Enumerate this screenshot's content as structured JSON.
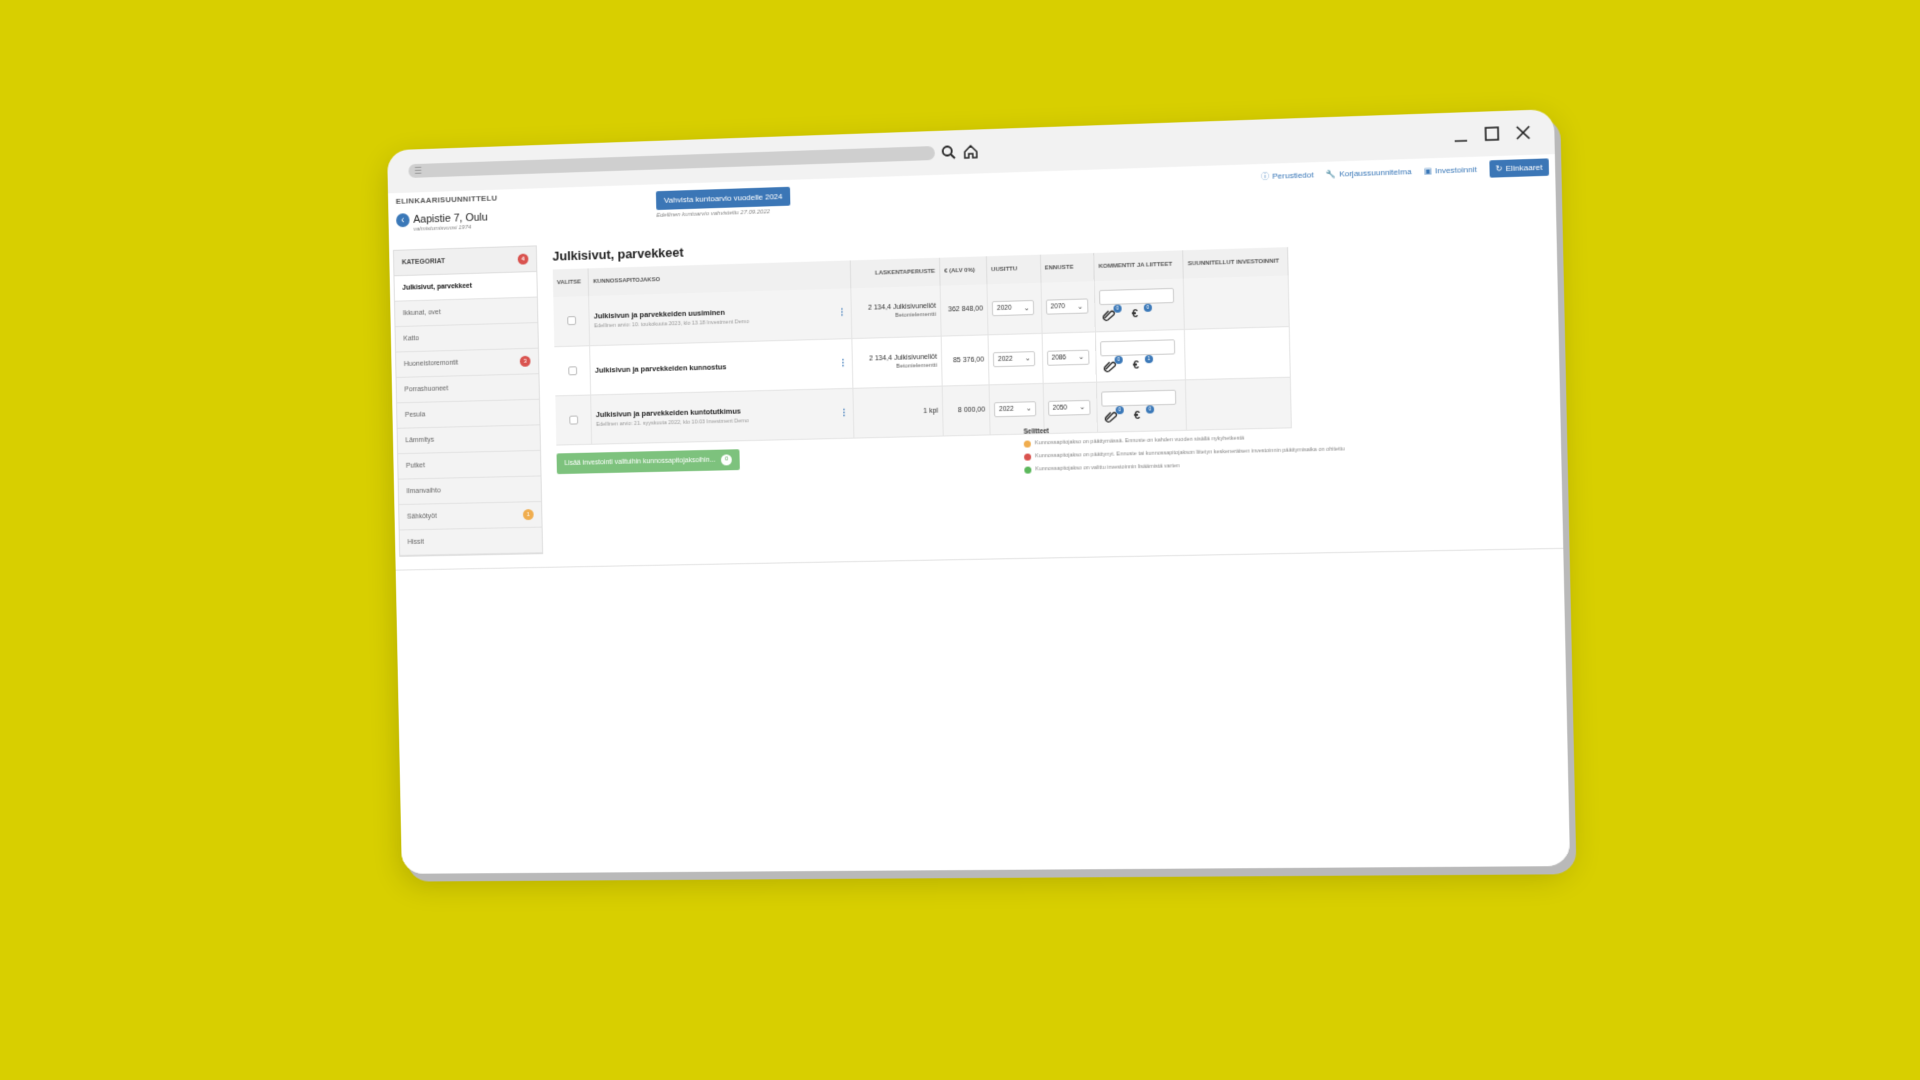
{
  "app": {
    "name": "ELINKAARISUUNNITTELU"
  },
  "property": {
    "address": "Aapistie 7, Oulu",
    "subtitle": "valmistumisvuosi 1974"
  },
  "confirm": {
    "label": "Vahvista kuntoarvio vuodelle 2024",
    "sub": "Edellinen kuntoarvio vahvistettu 27.09.2022"
  },
  "top_nav": [
    {
      "label": "Perustiedot",
      "icon": "info-icon"
    },
    {
      "label": "Korjaussuunnitelma",
      "icon": "wrench-icon"
    },
    {
      "label": "Investoinnit",
      "icon": "briefcase-icon"
    },
    {
      "label": "Elinkaaret",
      "icon": "refresh-icon"
    }
  ],
  "sidebar": {
    "header": "KATEGORIAT",
    "header_badge": "4",
    "items": [
      {
        "label": "Julkisivut, parvekkeet",
        "active": true,
        "badge": ""
      },
      {
        "label": "Ikkunat, ovet",
        "badge": ""
      },
      {
        "label": "Katto",
        "badge": ""
      },
      {
        "label": "Huoneistoremontit",
        "badge": "3",
        "badge_color": "#d9534f"
      },
      {
        "label": "Porrashuoneet",
        "badge": ""
      },
      {
        "label": "Pesula",
        "badge": ""
      },
      {
        "label": "Lämmitys",
        "badge": ""
      },
      {
        "label": "Putket",
        "badge": ""
      },
      {
        "label": "Ilmanvaihto",
        "badge": ""
      },
      {
        "label": "Sähkötyöt",
        "badge": "1",
        "badge_color": "#f0ad4e"
      },
      {
        "label": "Hissit",
        "badge": ""
      }
    ]
  },
  "main": {
    "title": "Julkisivut, parvekkeet",
    "columns": {
      "select": "VALITSE",
      "task": "KUNNOSSAPITOJAKSO",
      "basis": "LASKENTAPERUSTE",
      "price": "€ (ALV 0%)",
      "renewed": "UUSITTU",
      "forecast": "ENNUSTE",
      "comments": "KOMMENTIT JA LIITTEET",
      "planned": "SUUNNITELLUT INVESTOINNIT"
    },
    "rows": [
      {
        "name": "Julkisivun ja parvekkeiden uusiminen",
        "sub": "Edellinen arvio: 10. toukokuuta 2023, klo 13.18 Investment Demo",
        "basis": "2 134,4 Julkisivuneliöt",
        "basis2": "Betonielementti",
        "price": "362 848,00",
        "renewed": "2020",
        "forecast": "2070",
        "attach_count": "0",
        "euro_count": "0"
      },
      {
        "name": "Julkisivun ja parvekkeiden kunnostus",
        "sub": "",
        "basis": "2 134,4 Julkisivuneliöt",
        "basis2": "Betonielementti",
        "price": "85 376,00",
        "renewed": "2022",
        "forecast": "2086",
        "attach_count": "0",
        "euro_count": "1"
      },
      {
        "name": "Julkisivun ja parvekkeiden kuntotutkimus",
        "sub": "Edellinen arvio: 21. syyskuuta 2022, klo 10.03 Investment Demo",
        "basis": "1 kpl",
        "basis2": "",
        "price": "8 000,00",
        "renewed": "2022",
        "forecast": "2050",
        "attach_count": "0",
        "euro_count": "0"
      }
    ],
    "add_button": {
      "label": "Lisää investointi valituihin kunnossapitojaksoihin...",
      "count": "0"
    }
  },
  "legend": {
    "title": "Selitteet",
    "items": [
      {
        "color": "#f0ad4e",
        "text": "Kunnossapitojakso on päättymässä. Ennuste on kahden vuoden sisällä nykyhetkestä"
      },
      {
        "color": "#d9534f",
        "text": "Kunnossapitojakso on päättynyt. Ennuste tai kunnossapitojakson liitetyn keskeneräisen investoinnin päättymisaika on ohitettu"
      },
      {
        "color": "#5cb85c",
        "text": "Kunnossapitojakso on valittu investoinnin lisäämistä varten"
      }
    ]
  }
}
